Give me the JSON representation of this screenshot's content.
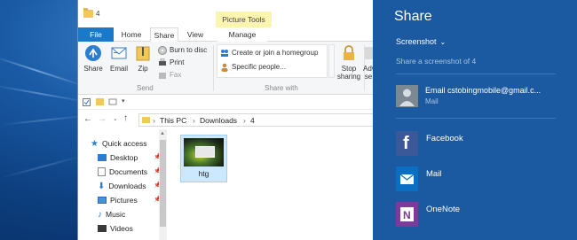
{
  "explorer": {
    "window_title": "4",
    "context_tab": "Picture Tools",
    "tabs": [
      "File",
      "Home",
      "Share",
      "View",
      "Manage"
    ],
    "ribbon": {
      "send": {
        "share": "Share",
        "email": "Email",
        "zip": "Zip",
        "burn": "Burn to disc",
        "print": "Print",
        "fax": "Fax",
        "group_label": "Send"
      },
      "share_with": {
        "homegroup": "Create or join a homegroup",
        "specific": "Specific people...",
        "group_label": "Share with"
      },
      "stop_sharing": "Stop sharing",
      "advanced": "Adv se"
    },
    "breadcrumb": [
      "This PC",
      "Downloads",
      "4"
    ],
    "nav": [
      {
        "label": "Quick access",
        "pinned": false
      },
      {
        "label": "Desktop",
        "pinned": true
      },
      {
        "label": "Documents",
        "pinned": true
      },
      {
        "label": "Downloads",
        "pinned": true
      },
      {
        "label": "Pictures",
        "pinned": true
      },
      {
        "label": "Music",
        "pinned": false
      },
      {
        "label": "Videos",
        "pinned": false
      }
    ],
    "files": [
      {
        "name": "htg",
        "selected": true
      }
    ]
  },
  "share_pane": {
    "title": "Share",
    "selector": "Screenshot",
    "description": "Share a screenshot of 4",
    "account": {
      "email": "Email cstobingmobile@gmail.c...",
      "app": "Mail"
    },
    "apps": [
      "Facebook",
      "Mail",
      "OneNote"
    ]
  },
  "colors": {
    "share_bg": "#1b5aa0",
    "file_tab": "#1979ca",
    "context_tab": "#fbf5b0",
    "facebook": "#3b5998",
    "mail": "#0a6fc2",
    "onenote": "#7a3b9a"
  }
}
